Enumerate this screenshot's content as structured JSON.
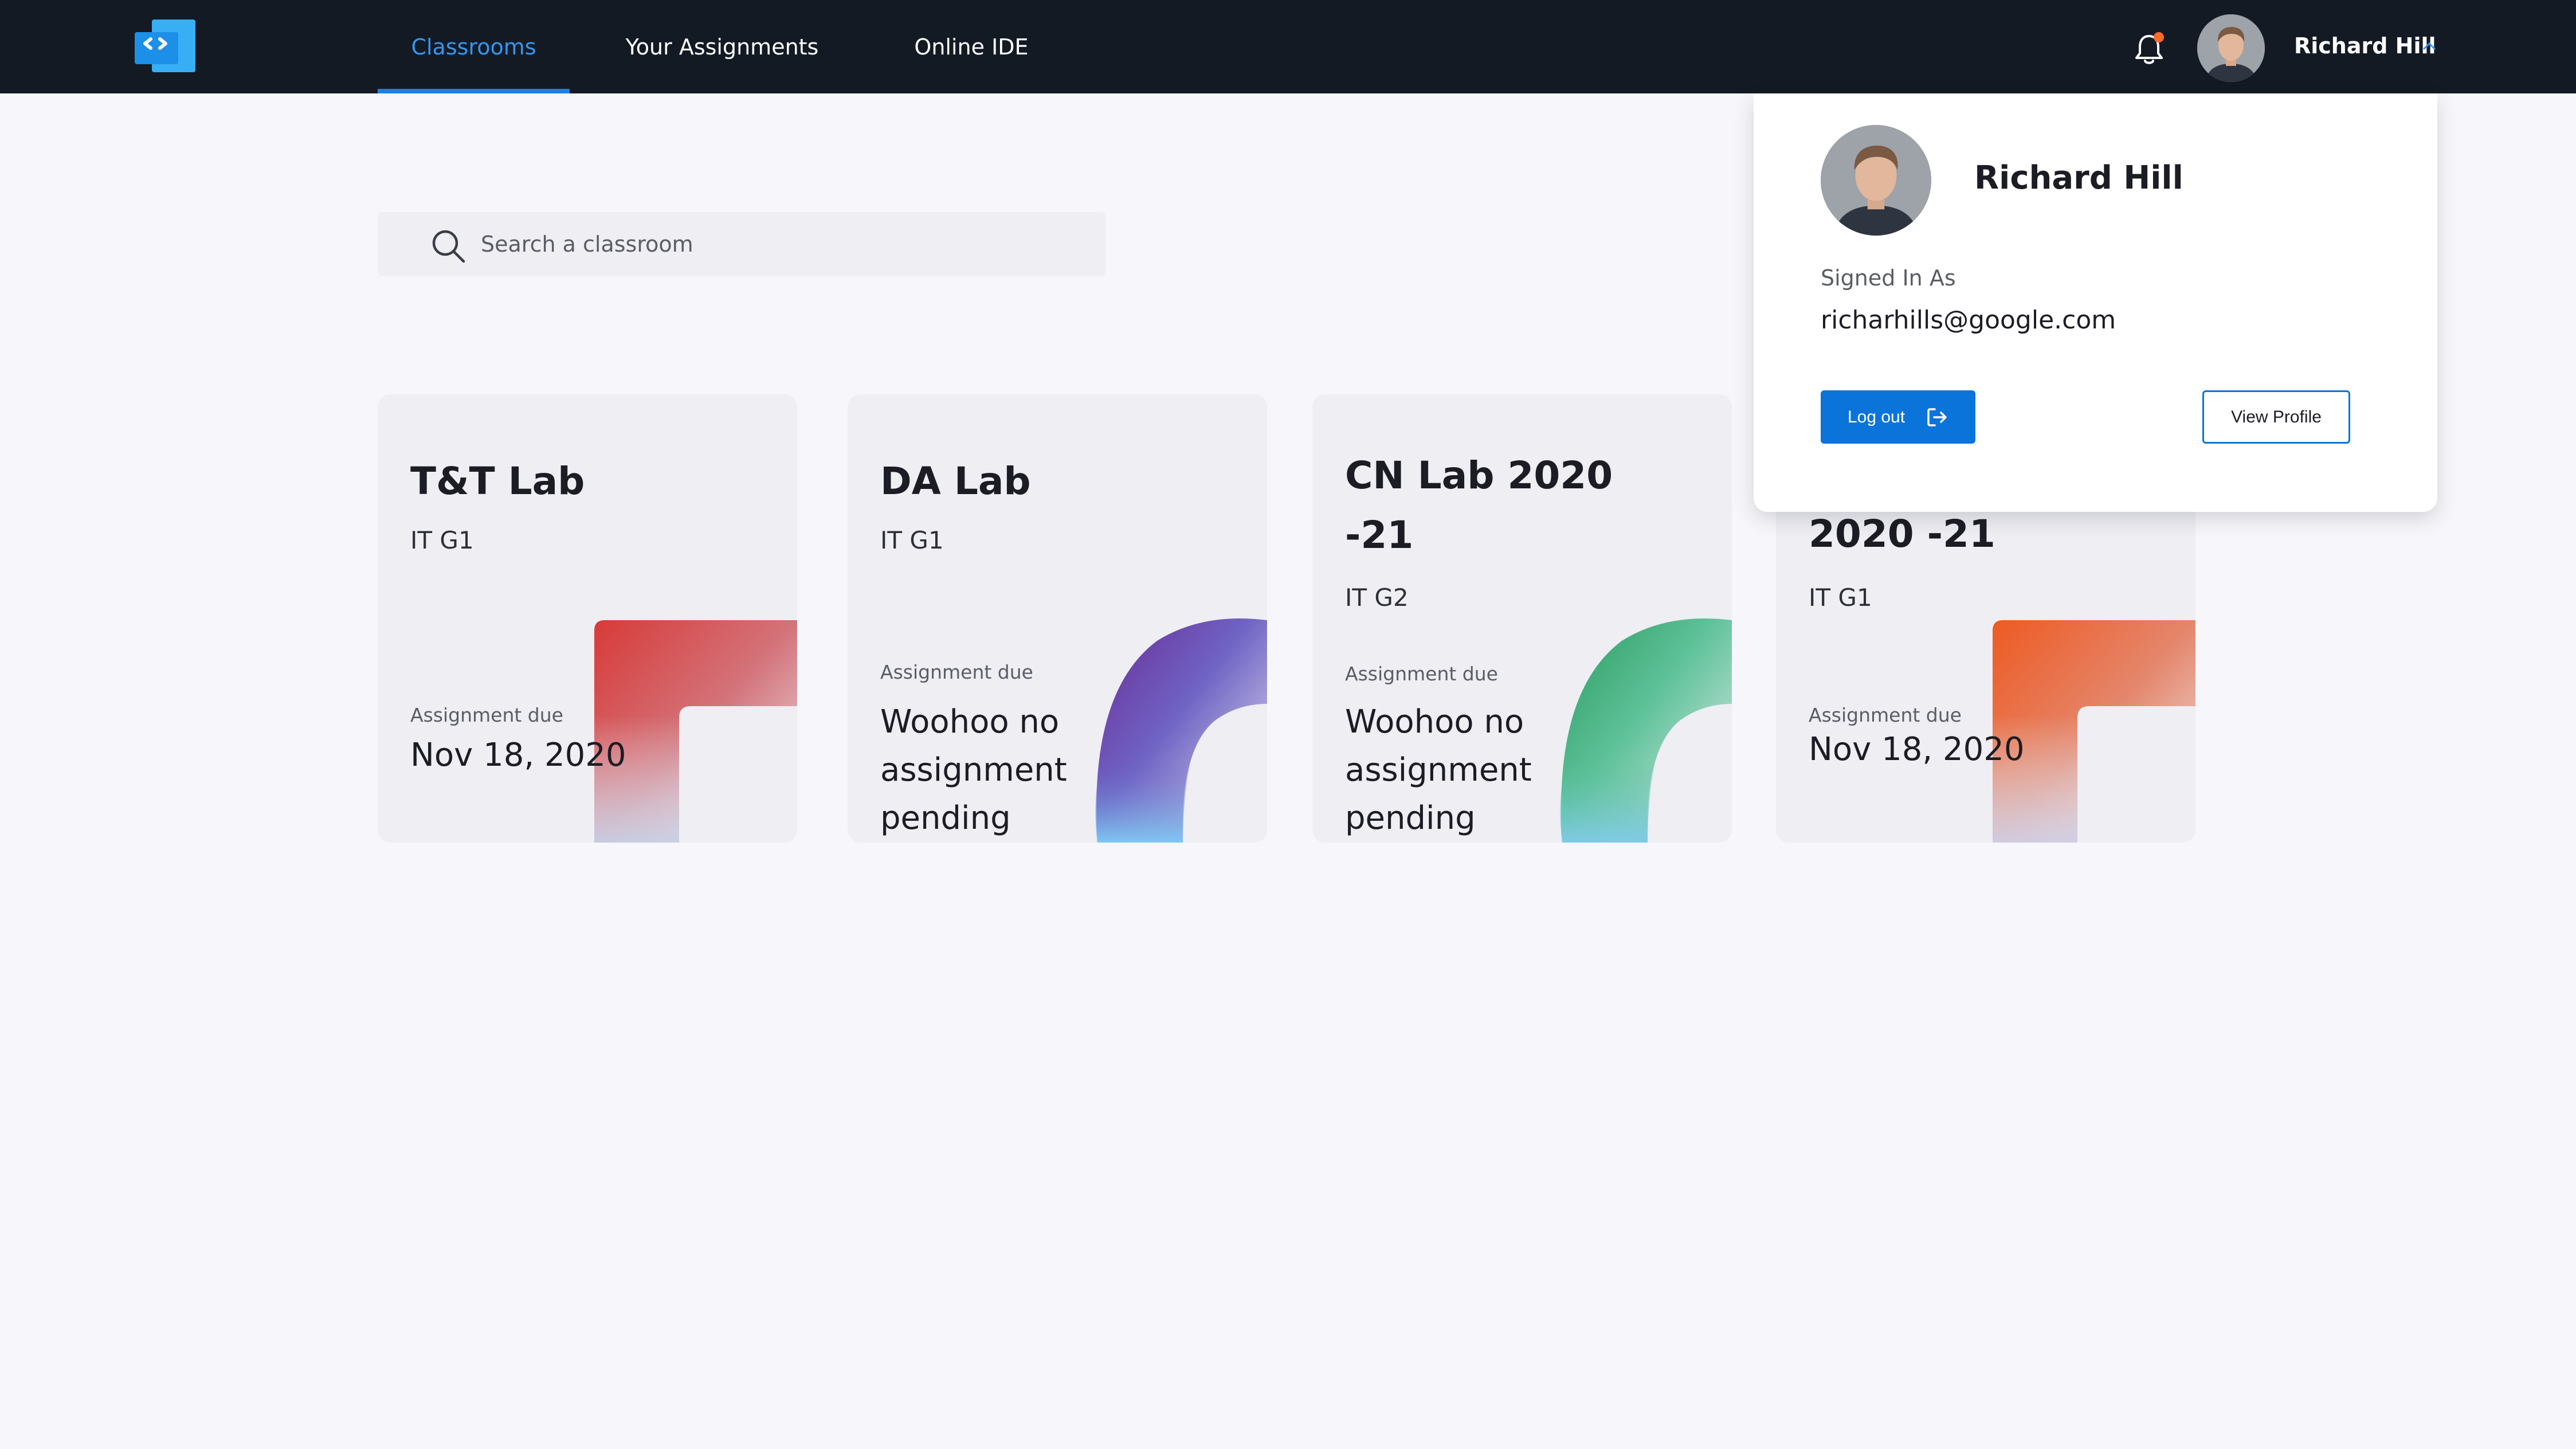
{
  "colors": {
    "navbar_bg": "#141a24",
    "accent": "#1f7fe0",
    "primary_button": "#0a74da",
    "notification_dot": "#ff6a2b",
    "page_bg": "#f7f7fb",
    "card_bg": "#eeeef3"
  },
  "navbar": {
    "logo_icon": "code-brackets-logo-icon",
    "tabs": [
      {
        "label": "Classrooms",
        "active": true
      },
      {
        "label": "Your Assignments",
        "active": false
      },
      {
        "label": "Online IDE",
        "active": false
      }
    ],
    "notification_icon": "bell-icon",
    "has_unread_notifications": true,
    "user": {
      "name": "Richard Hill",
      "menu_icon": "chevron-up-icon"
    }
  },
  "search": {
    "placeholder": "Search a classroom",
    "value": "",
    "icon": "search-icon"
  },
  "classrooms": [
    {
      "title": "T&T Lab",
      "group": "IT G1",
      "due_label": "Assignment due",
      "due_value": "Nov 18, 2020",
      "decoration": "red-gradient-corner"
    },
    {
      "title": "DA Lab",
      "group": "IT G1",
      "due_label": "Assignment due",
      "due_value": "Woohoo no assignment pending",
      "decoration": "purple-gradient-arc"
    },
    {
      "title": "CN Lab 2020 -21",
      "group": "IT G2",
      "due_label": "Assignment due",
      "due_value": "Woohoo no assignment pending",
      "decoration": "green-gradient-arc"
    },
    {
      "title": "2020 -21",
      "group": "IT G1",
      "due_label": "Assignment due",
      "due_value": "Nov 18, 2020",
      "decoration": "orange-gradient-corner"
    }
  ],
  "profile_menu": {
    "name": "Richard Hill",
    "signed_in_label": "Signed In As",
    "email": "richarhills@google.com",
    "logout_label": "Log out",
    "logout_icon": "logout-icon",
    "view_profile_label": "View Profile"
  }
}
